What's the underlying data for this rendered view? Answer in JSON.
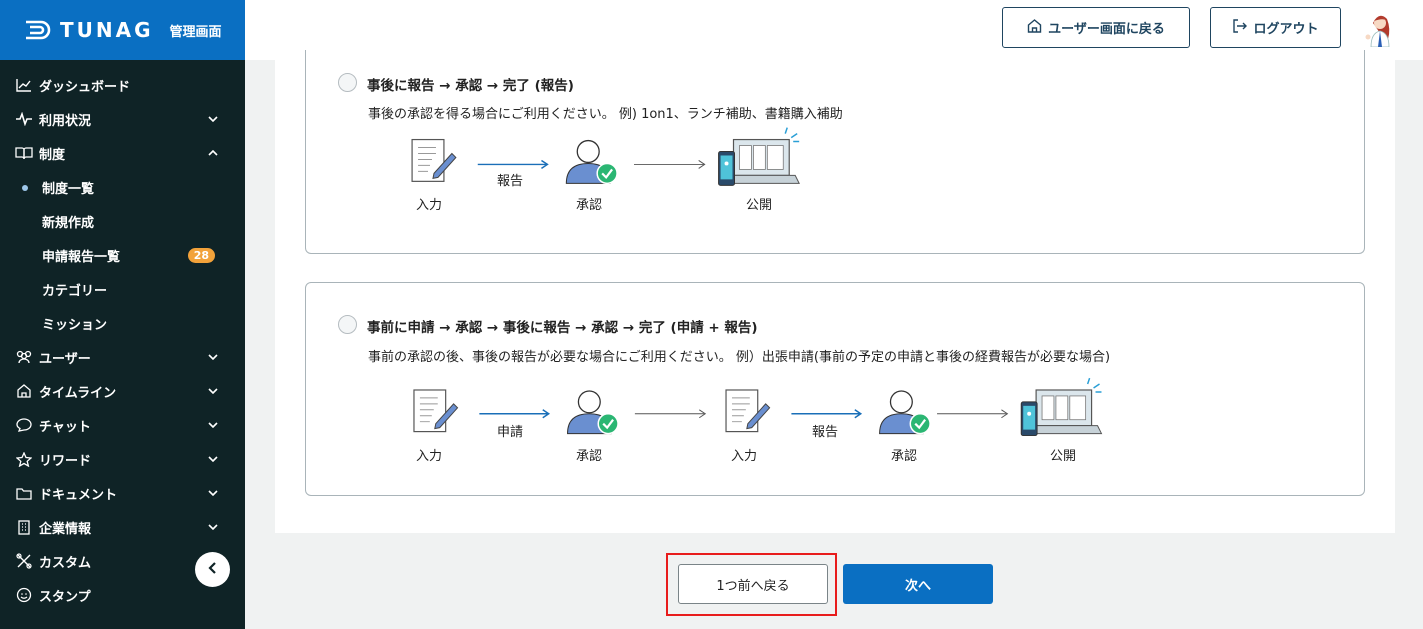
{
  "brand": {
    "name": "TUNAG",
    "sub": "管理画面"
  },
  "sidebar": {
    "items": [
      {
        "label": "ダッシュボード",
        "icon": "chart-icon"
      },
      {
        "label": "利用状況",
        "icon": "pulse-icon"
      },
      {
        "label": "制度",
        "icon": "book-icon"
      },
      {
        "label": "ユーザー",
        "icon": "users-icon"
      },
      {
        "label": "タイムライン",
        "icon": "home-icon"
      },
      {
        "label": "チャット",
        "icon": "chat-icon"
      },
      {
        "label": "リワード",
        "icon": "star-icon"
      },
      {
        "label": "ドキュメント",
        "icon": "folder-icon"
      },
      {
        "label": "企業情報",
        "icon": "building-icon"
      },
      {
        "label": "カスタム",
        "icon": "tools-icon"
      },
      {
        "label": "スタンプ",
        "icon": "stamp-icon"
      }
    ],
    "sub_items": [
      {
        "label": "制度一覧"
      },
      {
        "label": "新規作成"
      },
      {
        "label": "申請報告一覧",
        "badge": "28"
      },
      {
        "label": "カテゴリー"
      },
      {
        "label": "ミッション"
      }
    ]
  },
  "header": {
    "user_screen_label": "ユーザー画面に戻る",
    "logout_label": "ログアウト"
  },
  "options": [
    {
      "title": "事後に報告 → 承認 → 完了 (報告)",
      "description": "事後の承認を得る場合にご利用ください。 例) 1on1、ランチ補助、書籍購入補助",
      "flow": {
        "input": "入力",
        "arrow1": "報告",
        "approve": "承認",
        "publish": "公開"
      }
    },
    {
      "title": "事前に申請 → 承認 → 事後に報告 → 承認 → 完了 (申請 + 報告)",
      "description": "事前の承認の後、事後の報告が必要な場合にご利用ください。 例）出張申請(事前の予定の申請と事後の経費報告が必要な場合)",
      "flow": {
        "input1": "入力",
        "arrow1": "申請",
        "approve1": "承認",
        "input2": "入力",
        "arrow2": "報告",
        "approve2": "承認",
        "publish": "公開"
      }
    }
  ],
  "footer": {
    "back_label": "1つ前へ戻る",
    "next_label": "次へ"
  },
  "colors": {
    "brand": "#0a6fc2",
    "sidebar": "#0f2326",
    "highlight": "#e81c1c",
    "badge": "#f2a23a"
  }
}
